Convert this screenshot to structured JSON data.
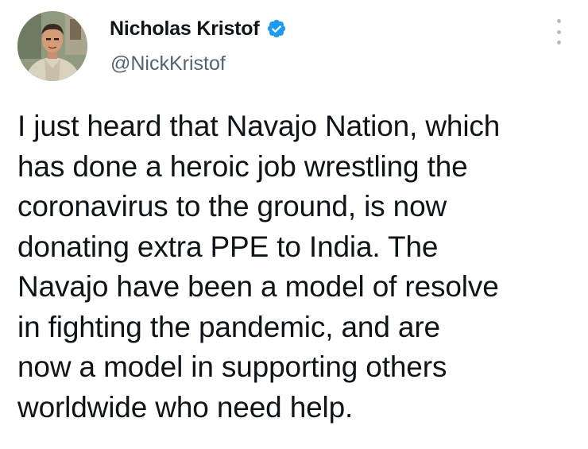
{
  "tweet": {
    "author": {
      "display_name": "Nicholas Kristof",
      "handle": "@NickKristof",
      "verified": true,
      "avatar_icon": "profile-photo"
    },
    "text": "I just heard that Navajo Nation, which\nhas done a heroic job wrestling the\ncoronavirus to the ground, is now\ndonating extra PPE to India. The\nNavajo have been a model of resolve\nin fighting the pandemic, and are\nnow a model in supporting others\nworldwide who need help.",
    "more_icon": "vertical-ellipsis-icon"
  },
  "colors": {
    "verified_blue": "#1d9bf0",
    "handle_gray": "#536471",
    "text_black": "#0f1419",
    "menu_dots": "#b4bcc3"
  }
}
